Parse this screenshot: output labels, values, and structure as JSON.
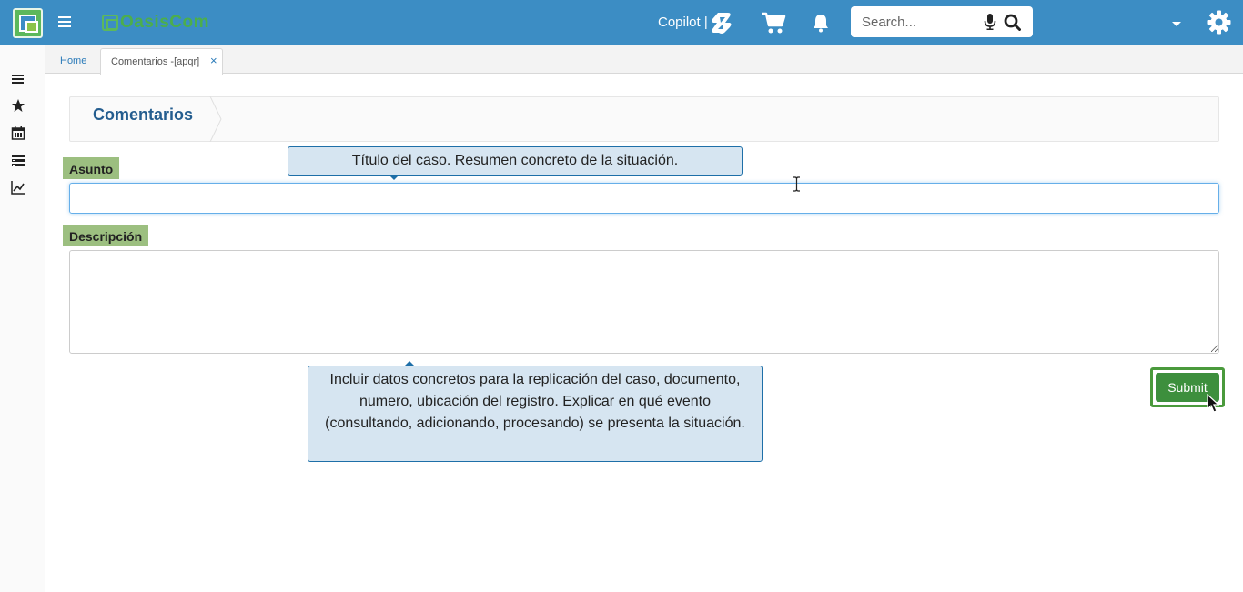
{
  "header": {
    "logo_text": "OasisCom",
    "copilot_label": "Copilot |",
    "search": {
      "placeholder": "Search...",
      "value": ""
    },
    "colors": {
      "bar": "#3c8dc4",
      "accent": "#5cb85c"
    }
  },
  "sidebar": {
    "icons": [
      "list-icon",
      "star-icon",
      "calendar-icon",
      "server-list-icon",
      "line-chart-icon"
    ]
  },
  "tabs": {
    "home_label": "Home",
    "active_label": "Comentarios -[apqr]",
    "close_glyph": "×"
  },
  "page": {
    "title": "Comentarios"
  },
  "form": {
    "asunto": {
      "label": "Asunto",
      "value": ""
    },
    "descripcion": {
      "label": "Descripción",
      "value": ""
    },
    "tooltip_asunto": "Título del caso. Resumen concreto de la situación.",
    "tooltip_descripcion": "Incluir datos concretos para la replicación del caso, documento, numero, ubicación del registro. Explicar en qué evento (consultando, adicionando, procesando) se presenta la situación.",
    "submit_label": "Submit"
  }
}
